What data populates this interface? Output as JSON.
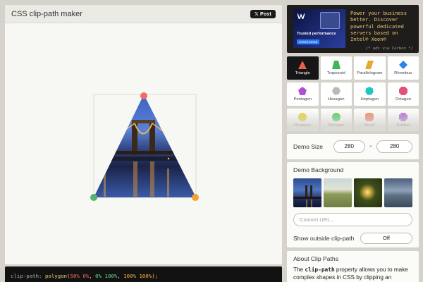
{
  "app": {
    "title": "CSS clip-path maker",
    "tweet_label": "Post"
  },
  "code": {
    "property": "clip-path:",
    "function": "polygon(",
    "p1": "50% 0%",
    "p2": "0% 100%",
    "p3": "100% 100%",
    "close": ");",
    "sep": ", "
  },
  "ad": {
    "image_caption": "Trusted performance",
    "image_cta": "LEARN MORE",
    "text": "Power your business better. Discover powerful dedicated servers based on Intel® Xeon®",
    "via": "/* ads via Carbon */"
  },
  "shapes": [
    {
      "label": "Triangle",
      "icon": "triangle-icon",
      "color": "#e8604a",
      "active": true
    },
    {
      "label": "Trapezoid",
      "icon": "trapezoid-icon",
      "color": "#3fb55d"
    },
    {
      "label": "Parallelogram",
      "icon": "parallelogram-icon",
      "color": "#e6a92b"
    },
    {
      "label": "Rhombus",
      "icon": "rhombus-icon",
      "color": "#2a84e6"
    },
    {
      "label": "Pentagon",
      "icon": "pentagon-icon",
      "color": "#b04fd6"
    },
    {
      "label": "Hexagon",
      "icon": "hexagon-icon",
      "color": "#b8b8b8"
    },
    {
      "label": "Heptagon",
      "icon": "heptagon-icon",
      "color": "#1fc7c2"
    },
    {
      "label": "Octagon",
      "icon": "octagon-icon",
      "color": "#e0507a"
    },
    {
      "label": "Nonagon",
      "icon": "nonagon-icon",
      "color": "#e6d53a"
    },
    {
      "label": "Decagon",
      "icon": "decagon-icon",
      "color": "#4ccf5a"
    },
    {
      "label": "Bevel",
      "icon": "bevel-icon",
      "color": "#f08a6a"
    },
    {
      "label": "Rabbet",
      "icon": "rabbet-icon",
      "color": "#b06ad4"
    }
  ],
  "demo_size": {
    "label": "Demo Size",
    "width": "280",
    "times": "×",
    "height": "280"
  },
  "demo_bg": {
    "label": "Demo Background",
    "custom_url_placeholder": "Custom URL...",
    "outside_label": "Show outside clip-path",
    "outside_value": "Off"
  },
  "about": {
    "title": "About Clip Paths",
    "text_before": "The ",
    "code": "clip-path",
    "text_after": " property allows you to make complex shapes in CSS by clipping an element"
  },
  "colors": {
    "point_top": "#ee6f5f",
    "point_left": "#57b46e",
    "point_right": "#f2a22d",
    "active_bg": "#161616"
  }
}
